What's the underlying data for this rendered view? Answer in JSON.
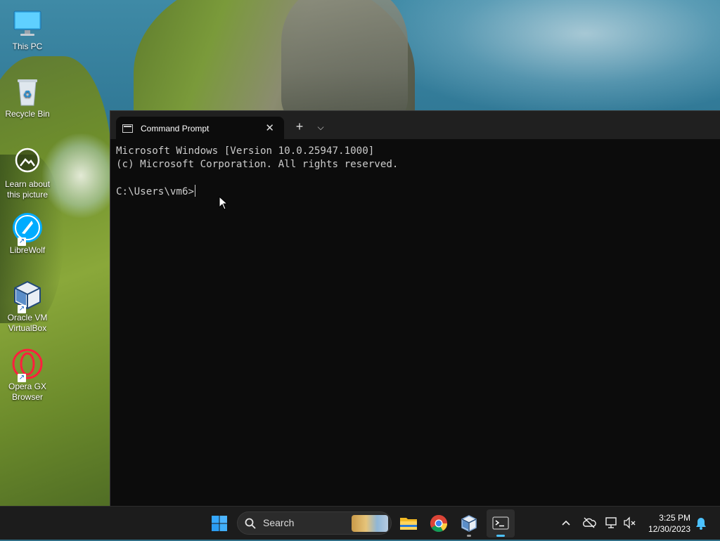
{
  "desktop": {
    "icons": [
      {
        "label": "This PC"
      },
      {
        "label": "Recycle Bin"
      },
      {
        "label": "Learn about this picture"
      },
      {
        "label": "LibreWolf"
      },
      {
        "label": "Oracle VM VirtualBox"
      },
      {
        "label": "Opera GX Browser"
      }
    ]
  },
  "terminal": {
    "tab_title": "Command Prompt",
    "lines": [
      "Microsoft Windows [Version 10.0.25947.1000]",
      "(c) Microsoft Corporation. All rights reserved.",
      "",
      "C:\\Users\\vm6>"
    ]
  },
  "taskbar": {
    "search_label": "Search",
    "clock_time": "3:25 PM",
    "clock_date": "12/30/2023"
  },
  "colors": {
    "terminal_bg": "#0c0c0c",
    "terminal_text": "#cccccc",
    "taskbar_bg": "#1c1c1c",
    "accent": "#4cc2ff"
  }
}
